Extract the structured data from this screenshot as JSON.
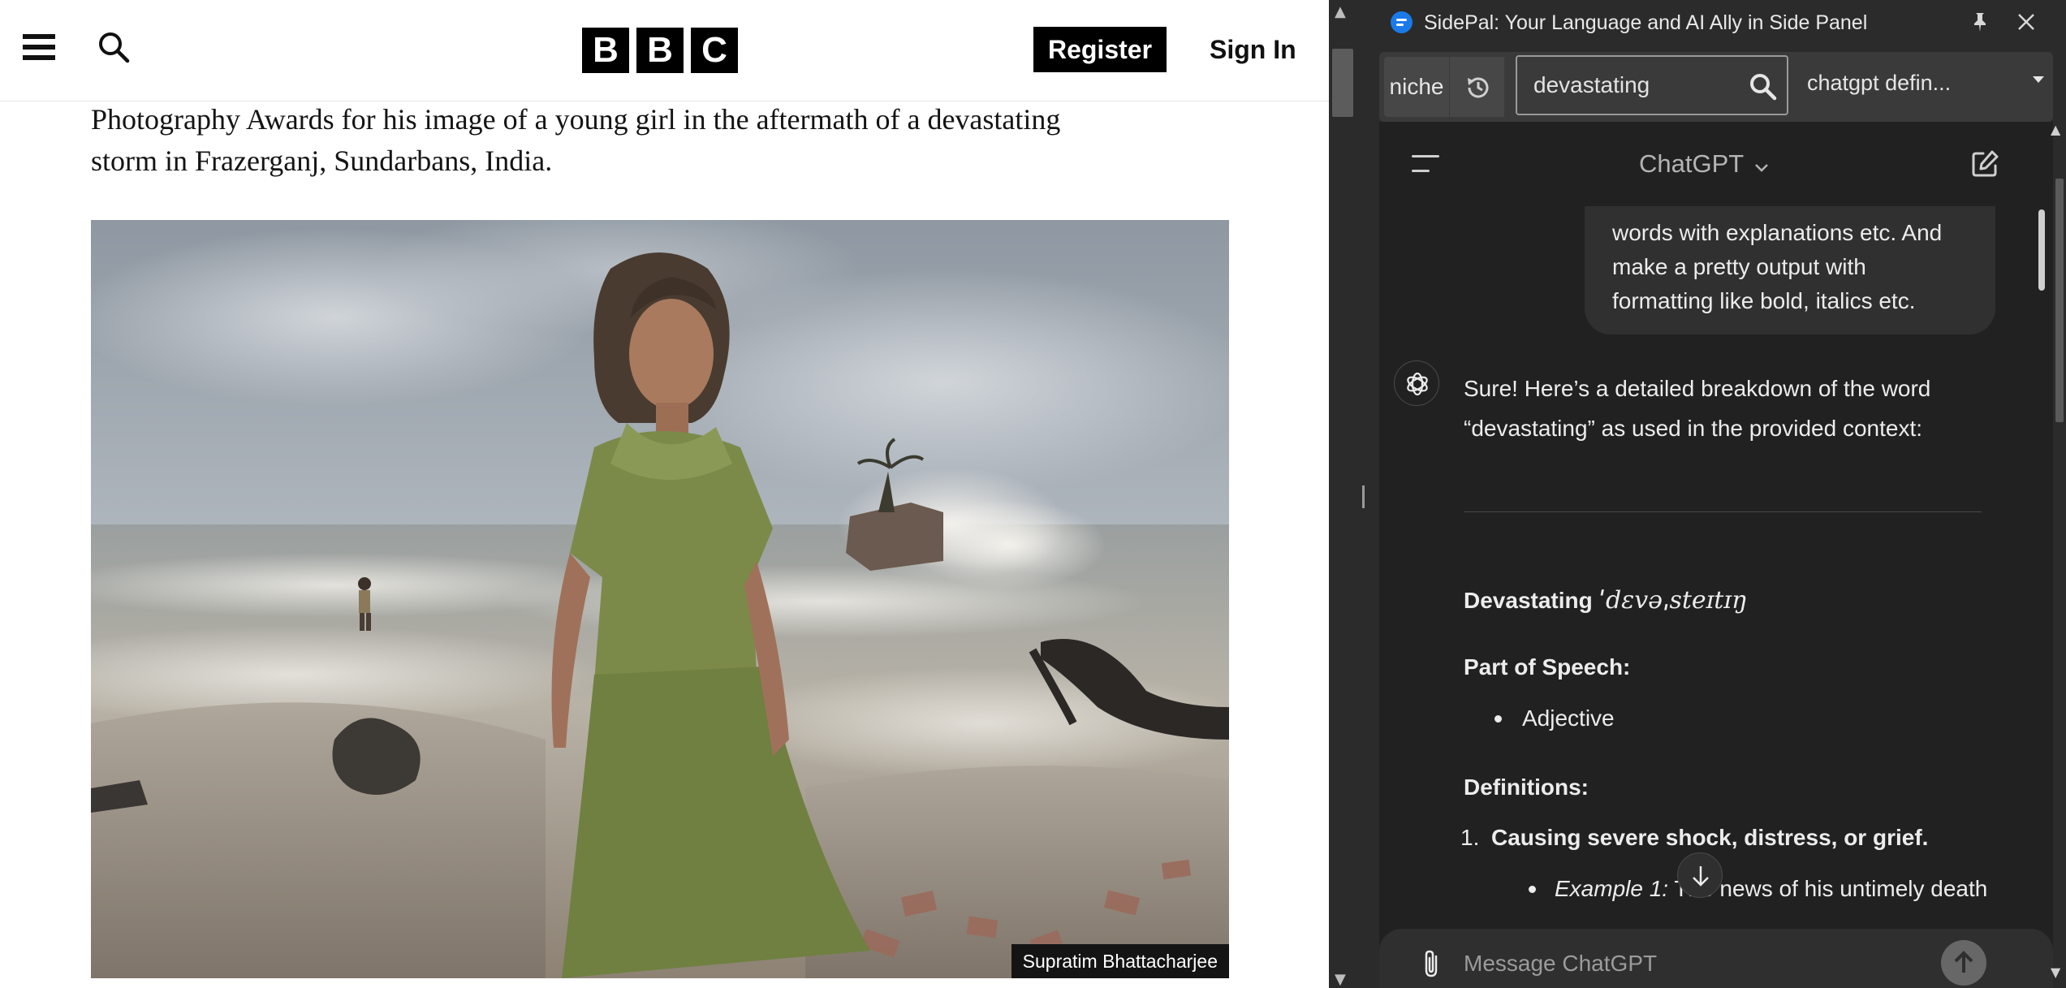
{
  "bbc": {
    "logo": [
      "B",
      "B",
      "C"
    ],
    "register_label": "Register",
    "signin_label": "Sign In",
    "article_line_1": "Photography Awards for his image of a young girl in the aftermath of a devastating",
    "article_line_2": "storm in Frazerganj, Sundarbans, India.",
    "photo_credit": "Supratim Bhattacharjee"
  },
  "sidepanel": {
    "title": "SidePal: Your Language and AI Ally in Side Panel",
    "toolbar": {
      "niche_label": "niche",
      "search_value": "devastating",
      "model_selected": "chatgpt defin..."
    },
    "chat": {
      "model_label": "ChatGPT",
      "user_message_lines": [
        "words with explanations etc. And",
        "make a pretty output with",
        "formatting like bold, italics etc."
      ],
      "intro_line_1": "Sure! Here’s a detailed breakdown of the word",
      "intro_line_2": "“devastating” as used in the provided context:",
      "word": "Devastating",
      "ipa": "ˈdɛvəˌsteɪtɪŋ",
      "pos_heading": "Part of Speech:",
      "pos_value": "Adjective",
      "definitions_heading": "Definitions:",
      "definition_1_number": "1.",
      "definition_1": "Causing severe shock, distress, or grief.",
      "example_1_label": "Example 1:",
      "example_1_text": " The news of his untimely death",
      "composer_placeholder": "Message ChatGPT"
    }
  },
  "colors": {
    "panel_bg": "#2b2b2b",
    "chat_bg": "#212121",
    "bubble_bg": "#303030",
    "accent_blue": "#1a7ae8"
  }
}
